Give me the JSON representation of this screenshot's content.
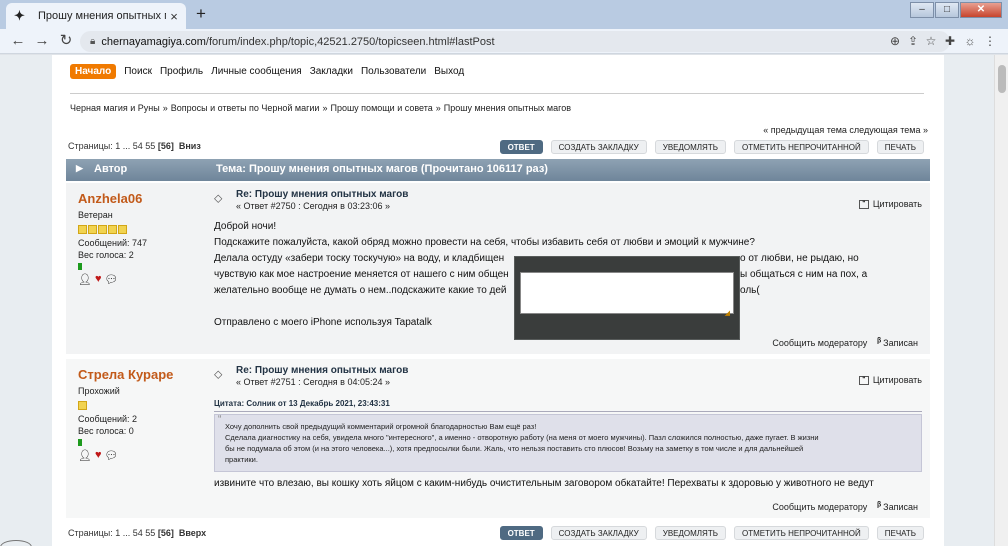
{
  "browser": {
    "tab_title": "Прошу мнения опытных магов",
    "url_host": "chernayamagiya.com",
    "url_path": "/forum/index.php/topic,42521.2750/topicseen.html#lastPost"
  },
  "menu": {
    "items": [
      "Начало",
      "Поиск",
      "Профиль",
      "Личные сообщения",
      "Закладки",
      "Пользователи",
      "Выход"
    ]
  },
  "breadcrumbs": [
    "Черная магия и Руны",
    "Вопросы и ответы по Черной магии",
    "Прошу помощи и совета",
    "Прошу мнения опытных магов"
  ],
  "breadcrumb_sep": "»",
  "prevnext": "« предыдущая тема следующая тема »",
  "pagination": {
    "label": "Страницы:",
    "pages": "1 ... 54 55",
    "current": "[56]",
    "down": "Вниз",
    "up": "Вверх"
  },
  "buttons": {
    "reply": "ОТВЕТ",
    "bookmark": "СОЗДАТЬ ЗАКЛАДКУ",
    "notify": "УВЕДОМЛЯТЬ",
    "mark_unread": "ОТМЕТИТЬ НЕПРОЧИТАННОЙ",
    "print": "ПЕЧАТЬ"
  },
  "header": {
    "author": "Автор",
    "topic": "Тема: Прошу мнения опытных магов  (Прочитано 106117 раз)"
  },
  "posts": [
    {
      "name": "Anzhela06",
      "rank": "Ветеран",
      "messages": "Сообщений: 747",
      "weight": "Вес голоса: 2",
      "title": "Re: Прошу мнения опытных магов",
      "meta": "« Ответ #2750 : Сегодня в 03:23:06 »",
      "quote": "Цитировать",
      "lines": [
        "Доброй ночи!",
        "Подскажите пожалуйста, какой обряд можно провести на себя, чтобы избавить себя от любви и эмоций к мужчине?",
        "Делала остуду «забери тоску тоскучую» на воду, и кладбищен",
        "чувствую как мое настроение меняется от нашего с ним общен",
        "желательно вообще не думать о нем..подскажите какие то дей"
      ],
      "lines_right": [
        "",
        "",
        "о от любви, не рыдаю, но",
        "ы общаться с ним на пох, а",
        "оль("
      ],
      "signature": "Отправлено с моего iPhone используя Tapatalk",
      "report": "Сообщить модератору",
      "logged": "Записан"
    },
    {
      "name": "Стрела Курарe",
      "rank": "Прохожий",
      "messages": "Сообщений: 2",
      "weight": "Вес голоса: 0",
      "title": "Re: Прошу мнения опытных магов",
      "meta": "« Ответ #2751 : Сегодня в 04:05:24 »",
      "quote": "Цитировать",
      "quote_head": "Цитата: Солник от 13 Декабрь 2021, 23:43:31",
      "quote_lines": [
        "Хочу дополнить свой предыдущий комментарий огромной благодарностью Вам ещё раз!",
        "Сделала диагностику на себя, увидела много \"интересного\", а именно - отворотную работу (на меня от моего мужчины). Пазл сложился полностью, даже пугает. В жизни",
        "бы не подумала об этом (и на этого человека...), хотя предпосылки были. Жаль, что нельзя поставить сто плюсов! Возьму на заметку в том числе и для дальнейшей",
        "практики."
      ],
      "text": "извините что влезаю,  вы кошку хоть яйцом с каким-нибудь очистительным заговором обкатайте!  Перехваты к здоровью у животного не ведут",
      "report": "Сообщить модератору",
      "logged": "Записан"
    }
  ]
}
